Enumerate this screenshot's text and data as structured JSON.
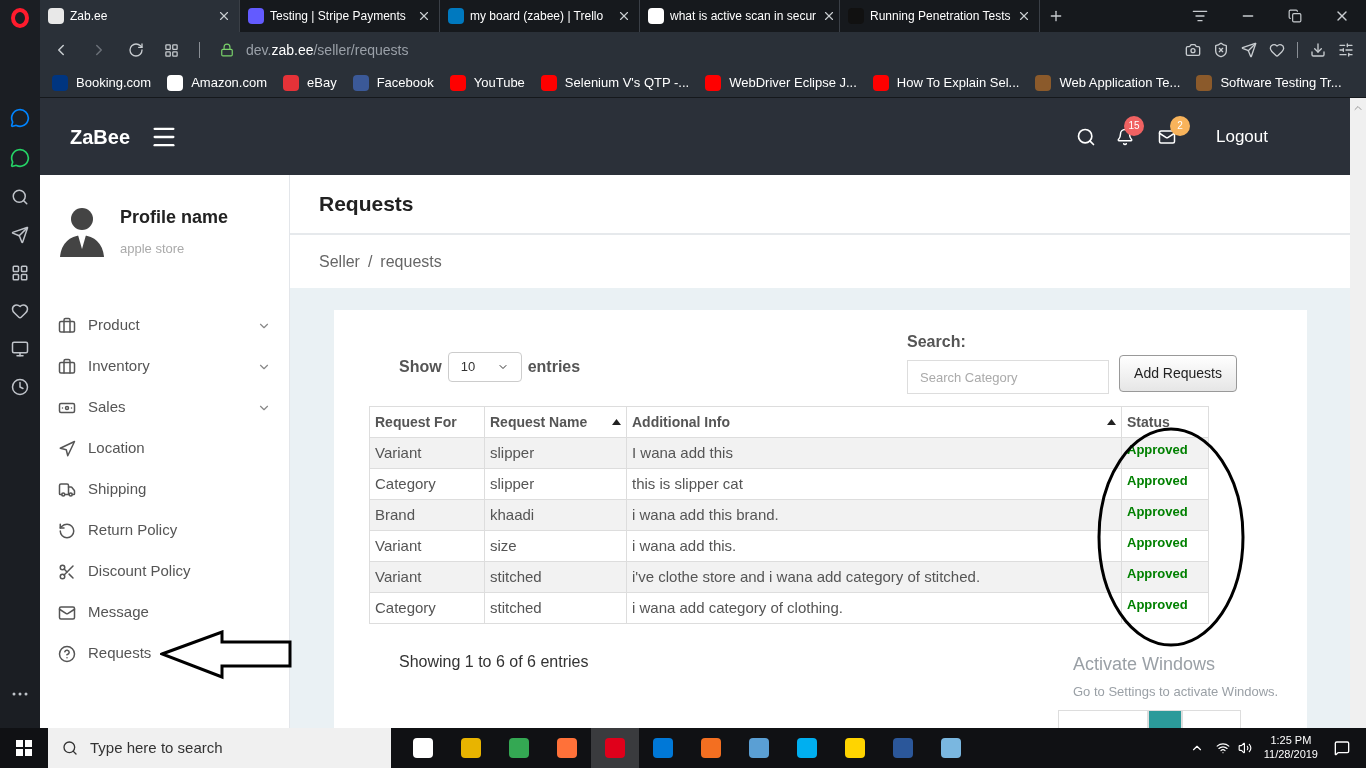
{
  "browser": {
    "tabs": [
      {
        "title": "Zab.ee",
        "selected": true
      },
      {
        "title": "Testing | Stripe Payments",
        "selected": false
      },
      {
        "title": "my board (zabee) | Trello",
        "selected": false
      },
      {
        "title": "what is active scan in secur",
        "selected": false
      },
      {
        "title": "Running Penetration Tests",
        "selected": false
      }
    ],
    "address": "dev.**zab.ee**/seller/requests",
    "bookmarks": [
      "Booking.com",
      "Amazon.com",
      "eBay",
      "Facebook",
      "YouTube",
      "Selenium V's QTP -...",
      "WebDriver Eclipse J...",
      "How To Explain Sel...",
      "Web Application Te...",
      "Software Testing Tr..."
    ]
  },
  "header": {
    "brand": "ZaBee",
    "notifications": "15",
    "messages": "2",
    "logout": "Logout"
  },
  "profile": {
    "name": "Profile name",
    "store": "apple store"
  },
  "menu": [
    {
      "label": "Product",
      "expandable": true
    },
    {
      "label": "Inventory",
      "expandable": true
    },
    {
      "label": "Sales",
      "expandable": true
    },
    {
      "label": "Location",
      "expandable": false
    },
    {
      "label": "Shipping",
      "expandable": false
    },
    {
      "label": "Return Policy",
      "expandable": false
    },
    {
      "label": "Discount Policy",
      "expandable": false
    },
    {
      "label": "Message",
      "expandable": false
    },
    {
      "label": "Requests",
      "expandable": false
    }
  ],
  "page_title": "Requests",
  "breadcrumb": {
    "items": [
      "Seller",
      "requests"
    ],
    "separator": "/"
  },
  "table_controls": {
    "show": "Show",
    "page_size": "10",
    "entries": "entries",
    "search_label": "Search:",
    "search_placeholder": "Search Category",
    "add_button": "Add Requests"
  },
  "table": {
    "columns": [
      {
        "label": "Request For",
        "sorted_ascending": false
      },
      {
        "label": "Request Name",
        "sorted_ascending": true
      },
      {
        "label": "Additional Info",
        "sorted_ascending": true
      },
      {
        "label": "Status",
        "sorted_ascending": false
      }
    ],
    "rows": [
      [
        "Variant",
        "slipper",
        "I wana add this",
        "Approved"
      ],
      [
        "Category",
        "slipper",
        "this is slipper cat",
        "Approved"
      ],
      [
        "Brand",
        "khaadi",
        "i wana add this brand.",
        "Approved"
      ],
      [
        "Variant",
        "size",
        "i wana add this.",
        "Approved"
      ],
      [
        "Variant",
        "stitched",
        "i've clothe store and i wana add category of stitched.",
        "Approved"
      ],
      [
        "Category",
        "stitched",
        "i wana add category of clothing.",
        "Approved"
      ]
    ]
  },
  "table_info": "Showing 1 to 6 of 6 entries",
  "pagination": [
    {
      "selected": false
    },
    {
      "selected": true
    },
    {
      "selected": false
    }
  ],
  "activation": {
    "title": "Activate Windows",
    "subtitle": "Go to Settings to activate Windows."
  },
  "taskbar": {
    "search_placeholder": "Type here to search",
    "apps": [
      {
        "selected": false
      },
      {
        "selected": false
      },
      {
        "selected": false
      },
      {
        "selected": false
      },
      {
        "selected": true
      },
      {
        "selected": false
      },
      {
        "selected": false
      },
      {
        "selected": false
      },
      {
        "selected": false
      },
      {
        "selected": false
      },
      {
        "selected": false
      },
      {
        "selected": false
      }
    ],
    "time": "1:25 PM",
    "date": "11/28/2019"
  }
}
